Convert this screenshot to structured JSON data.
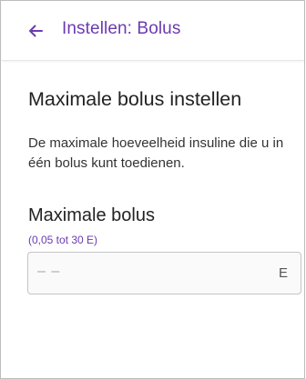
{
  "appbar": {
    "title": "Instellen: Bolus",
    "back_icon": "arrow-left-icon",
    "accent_color": "#6a3bb0"
  },
  "main": {
    "heading": "Maximale bolus instellen",
    "description": "De maximale hoeveelheid insuline die u in één bolus kunt toedienen.",
    "field": {
      "label": "Maximale bolus",
      "range": "(0,05 tot 30 E)",
      "value": "– –",
      "unit": "E"
    }
  }
}
